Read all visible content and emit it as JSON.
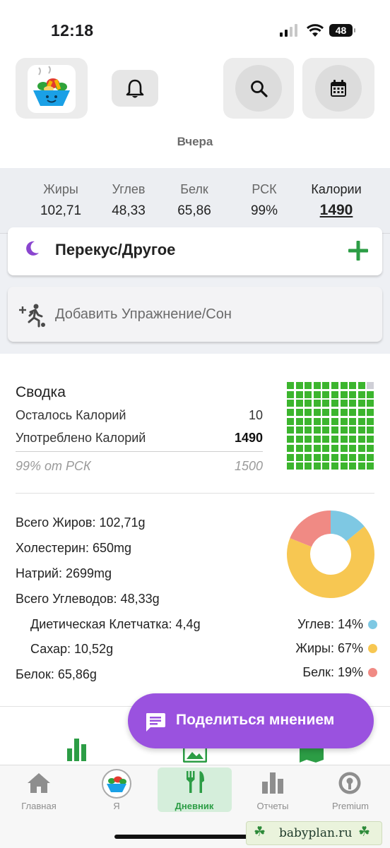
{
  "status_bar": {
    "time": "12:18",
    "battery": "48"
  },
  "header": {
    "date_label": "Вчера"
  },
  "macros": [
    {
      "label": "Жиры",
      "value": "102,71"
    },
    {
      "label": "Углев",
      "value": "48,33"
    },
    {
      "label": "Белк",
      "value": "65,86"
    },
    {
      "label": "РСК",
      "value": "99%"
    },
    {
      "label": "Калории",
      "value": "1490"
    }
  ],
  "meal": {
    "title": "Перекус/Другое"
  },
  "exercise": {
    "label": "Добавить Упражнение/Сон"
  },
  "summary": {
    "title": "Сводка",
    "remaining_label": "Осталось Калорий",
    "remaining_value": "10",
    "consumed_label": "Употреблено Калорий",
    "consumed_value": "1490",
    "rsk_label": "99% от РСК",
    "rsk_value": "1500",
    "grid_filled": 99,
    "grid_total": 100
  },
  "nutrition": {
    "fat": "Всего Жиров: 102,71g",
    "cholesterol": "Холестерин: 650mg",
    "sodium": "Натрий: 2699mg",
    "carbs": "Всего Углеводов: 48,33g",
    "fiber": "Диетическая Клетчатка: 4,4g",
    "sugar": "Сахар: 10,52g",
    "protein": "Белок: 65,86g"
  },
  "chart_data": {
    "type": "pie",
    "categories": [
      "Углев",
      "Жиры",
      "Белк"
    ],
    "values": [
      14,
      67,
      19
    ],
    "labels": [
      "Углев: 14%",
      "Жиры: 67%",
      "Белк: 19%"
    ],
    "colors": [
      "#7ec8e3",
      "#f7c752",
      "#f08a84"
    ]
  },
  "share": {
    "label": "Поделиться мнением"
  },
  "tabs": [
    {
      "label": "Главная"
    },
    {
      "label": "Я"
    },
    {
      "label": "Дневник"
    },
    {
      "label": "Отчеты"
    },
    {
      "label": "Premium"
    }
  ],
  "watermark": {
    "text": "babyplan.ru"
  },
  "colors": {
    "accent_green": "#2c9d45",
    "share_purple": "#9a52df",
    "grid_green": "#3cb52e"
  }
}
